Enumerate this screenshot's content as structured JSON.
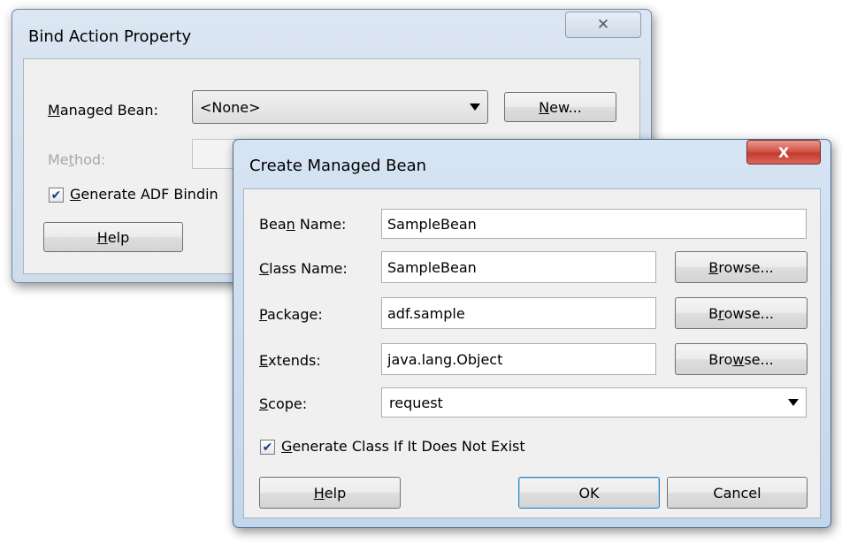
{
  "bind_dialog": {
    "title": "Bind Action Property",
    "managed_bean_label_u": "M",
    "managed_bean_label_rest": "anaged Bean:",
    "managed_bean_value": "<None>",
    "new_button_u": "N",
    "new_button_rest": "ew...",
    "method_label_pre": "Me",
    "method_label_u": "t",
    "method_label_rest": "hod:",
    "generate_checkbox_u": "G",
    "generate_checkbox_rest": "enerate ADF Bindin",
    "help_button_u": "H",
    "help_button_rest": "elp",
    "close_glyph": "✕"
  },
  "create_dialog": {
    "title": "Create Managed Bean",
    "close_glyph": "X",
    "bean_name_label_pre": "Bea",
    "bean_name_label_u": "n",
    "bean_name_label_rest": " Name:",
    "bean_name_value": "SampleBean",
    "class_name_label_u": "C",
    "class_name_label_rest": "lass Name:",
    "class_name_value": "SampleBean",
    "package_label_u": "P",
    "package_label_rest": "ackage:",
    "package_value": "adf.sample",
    "extends_label_u": "E",
    "extends_label_rest": "xtends:",
    "extends_value": "java.lang.Object",
    "browse1_u": "B",
    "browse1_rest": "rowse...",
    "browse2_pre": "B",
    "browse2_u": "r",
    "browse2_rest": "owse...",
    "browse3_pre": "Bro",
    "browse3_u": "w",
    "browse3_rest": "se...",
    "scope_label_u": "S",
    "scope_label_rest": "cope:",
    "scope_value": "request",
    "generate_checkbox_u": "G",
    "generate_checkbox_rest": "enerate Class If It Does Not Exist",
    "help_button_u": "H",
    "help_button_rest": "elp",
    "ok_button": "OK",
    "cancel_button": "Cancel"
  },
  "colors": {
    "frame": "#c4d6ea",
    "frame_inactive": "#d5e1ee",
    "close_red": "#c9463d"
  }
}
